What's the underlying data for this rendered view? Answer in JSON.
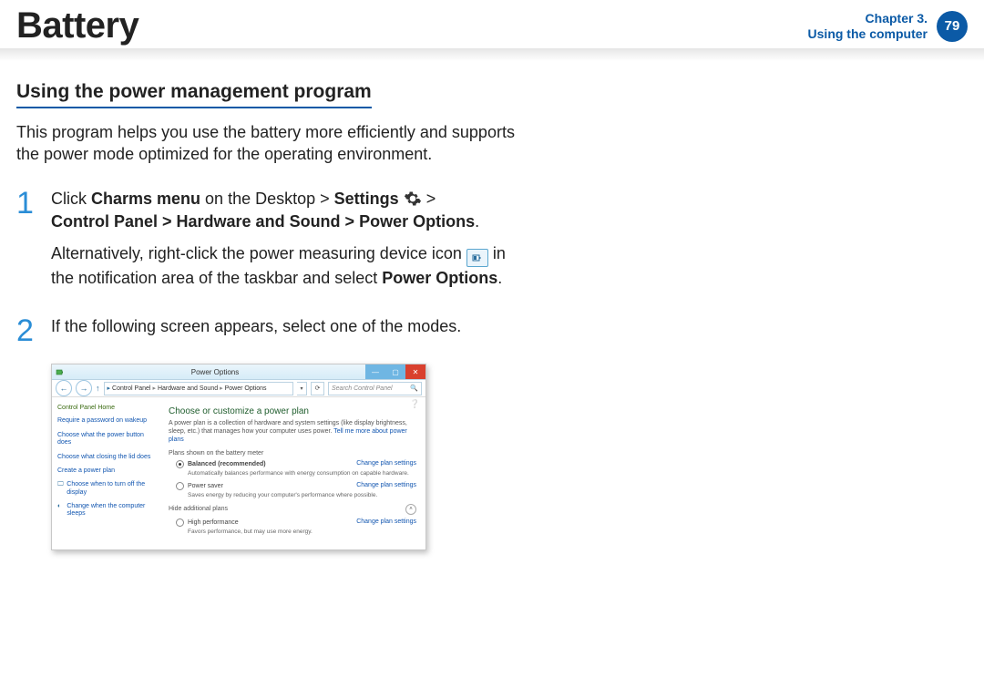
{
  "header": {
    "title": "Battery",
    "chapter": "Chapter 3.",
    "section": "Using the computer",
    "page": "79"
  },
  "section_title": "Using the power management program",
  "lead": "This program helps you use the battery more efficiently and supports the power mode optimized for the operating environment.",
  "step1": {
    "num": "1",
    "l1a": "Click ",
    "l1b": "Charms menu",
    "l1c": " on the Desktop > ",
    "l1d": "Settings",
    "l1e": " > ",
    "l2a": "Control Panel > Hardware and Sound > Power Options",
    "period": ".",
    "l3a": "Alternatively, right-click the power measuring device icon ",
    "l3b": " in the notification area of the taskbar and select ",
    "l3c": "Power Options",
    "l3d": "."
  },
  "step2": {
    "num": "2",
    "text": "If the following screen appears, select one of the modes."
  },
  "shot": {
    "title": "Power Options",
    "crumb": {
      "c1": "Control Panel",
      "c2": "Hardware and Sound",
      "c3": "Power Options"
    },
    "search_ph": "Search Control Panel",
    "side": {
      "home": "Control Panel Home",
      "s1": "Require a password on wakeup",
      "s2": "Choose what the power button does",
      "s3": "Choose what closing the lid does",
      "s4": "Create a power plan",
      "s5": "Choose when to turn off the display",
      "s6": "Change when the computer sleeps"
    },
    "main": {
      "h": "Choose or customize a power plan",
      "desc": "A power plan is a collection of hardware and system settings (like display brightness, sleep, etc.) that manages how your computer uses power. ",
      "tell": "Tell me more about power plans",
      "plans_hd": "Plans shown on the battery meter",
      "p1": {
        "name": "Balanced (recommended)",
        "sub": "Automatically balances performance with energy consumption on capable hardware."
      },
      "p2": {
        "name": "Power saver",
        "sub": "Saves energy by reducing your computer's performance where possible."
      },
      "hide": "Hide additional plans",
      "p3": {
        "name": "High performance",
        "sub": "Favors performance, but may use more energy."
      },
      "change": "Change plan settings"
    }
  }
}
